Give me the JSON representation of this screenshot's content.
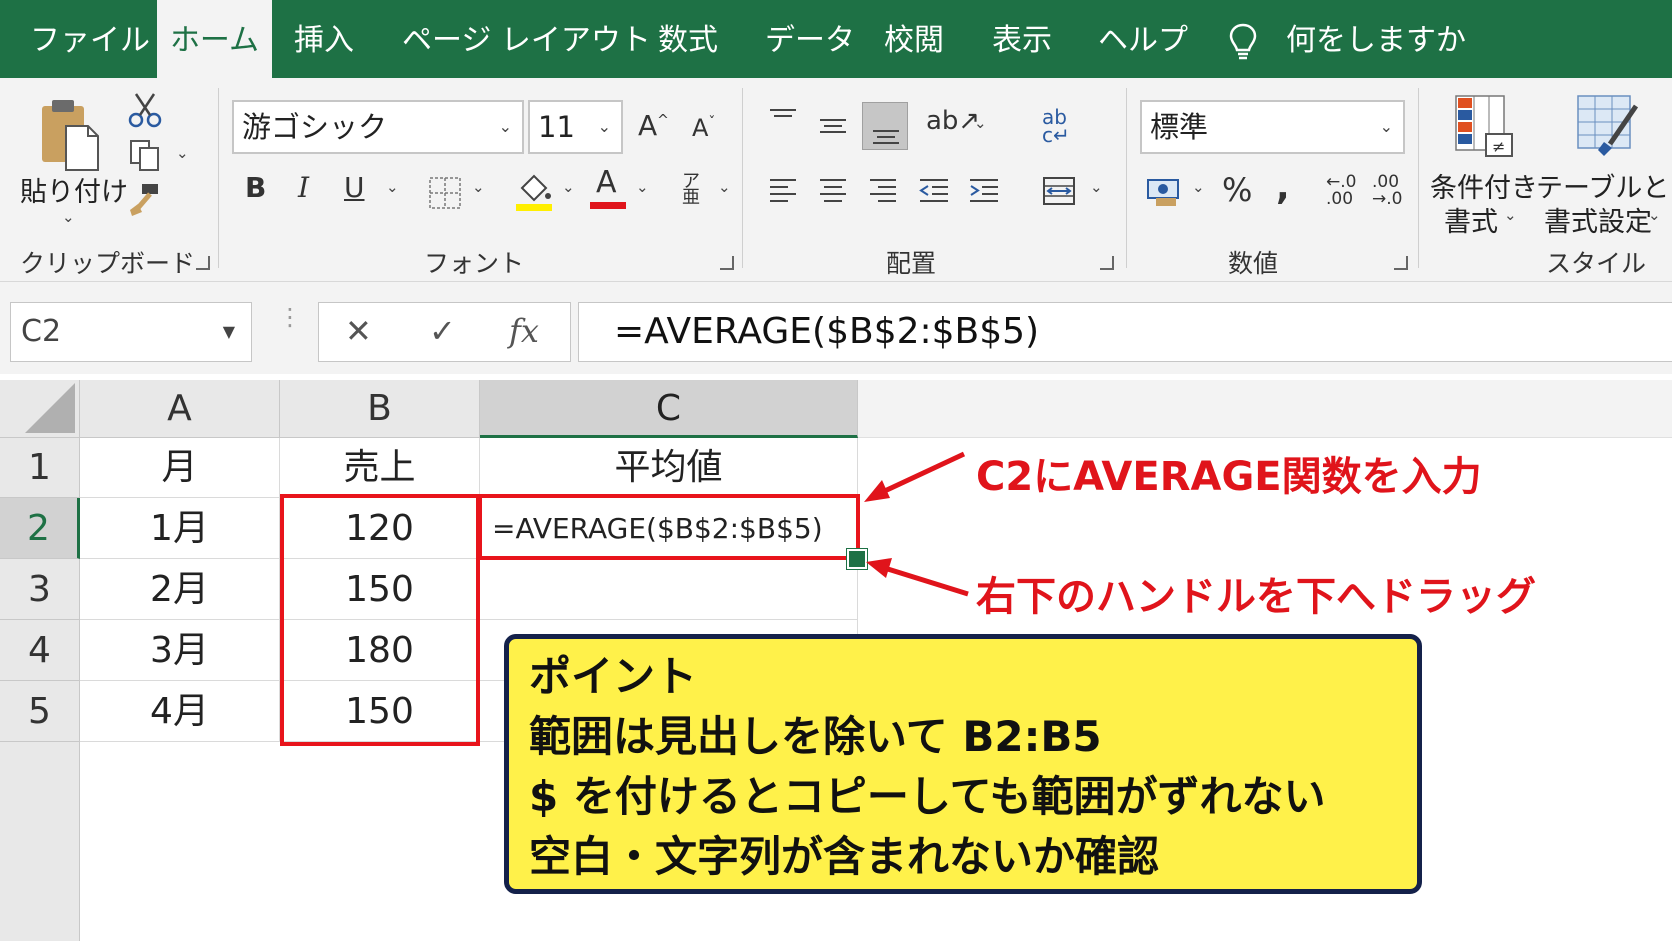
{
  "menu": {
    "tabs": [
      {
        "label": "ファイル",
        "active": false
      },
      {
        "label": "ホーム",
        "active": true
      },
      {
        "label": "挿入",
        "active": false
      },
      {
        "label": "ページ レイアウト",
        "active": false
      },
      {
        "label": "数式",
        "active": false
      },
      {
        "label": "データ",
        "active": false
      },
      {
        "label": "校閲",
        "active": false
      },
      {
        "label": "表示",
        "active": false
      },
      {
        "label": "ヘルプ",
        "active": false
      }
    ],
    "tell_me": "何をしますか"
  },
  "ribbon": {
    "clipboard": {
      "paste_label": "貼り付け",
      "group_label": "クリップボード"
    },
    "font": {
      "font_name": "游ゴシック",
      "font_size": "11",
      "group_label": "フォント"
    },
    "alignment": {
      "group_label": "配置"
    },
    "number": {
      "format": "標準",
      "group_label": "数値"
    },
    "styles": {
      "conditional_line1": "条件付き",
      "conditional_line2": "書式",
      "table_line1": "テーブルとして",
      "table_line2": "書式設定",
      "group_label": "スタイル"
    }
  },
  "formula_bar": {
    "name_box": "C2",
    "formula": "=AVERAGE($B$2:$B$5)"
  },
  "sheet": {
    "columns": [
      "A",
      "B",
      "C"
    ],
    "selected_column": "C",
    "selected_row": "2",
    "rows": [
      {
        "num": "1",
        "cells": [
          "月",
          "売上",
          "平均値"
        ]
      },
      {
        "num": "2",
        "cells": [
          "1月",
          "120",
          "=AVERAGE($B$2:$B$5)"
        ]
      },
      {
        "num": "3",
        "cells": [
          "2月",
          "150",
          ""
        ]
      },
      {
        "num": "4",
        "cells": [
          "3月",
          "180",
          ""
        ]
      },
      {
        "num": "5",
        "cells": [
          "4月",
          "150",
          ""
        ]
      }
    ]
  },
  "annotations": {
    "callout_input": "C2にAVERAGE関数を入力",
    "callout_drag": "右下のハンドルを下へドラッグ",
    "note_lines": [
      "ポイント",
      "範囲は見出しを除いて B2:B5",
      "$ を付けるとコピーしても範囲がずれない",
      "空白・文字列が含まれないか確認"
    ]
  },
  "colors": {
    "excel_green": "#1e7145",
    "annotation_red": "#e0141b",
    "note_yellow": "#fff14a",
    "note_border": "#14214a"
  }
}
